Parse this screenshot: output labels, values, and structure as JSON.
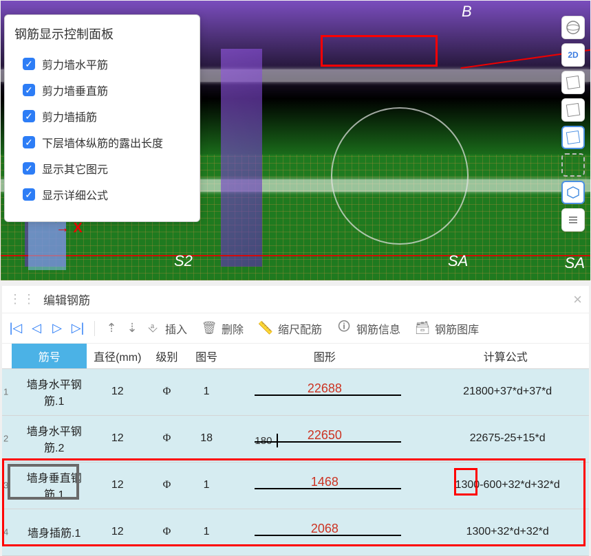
{
  "panel": {
    "title": "钢筋显示控制面板",
    "items": [
      "剪力墙水平筋",
      "剪力墙垂直筋",
      "剪力墙插筋",
      "下层墙体纵筋的露出长度",
      "显示其它图元",
      "显示详细公式"
    ]
  },
  "side_toolbar": {
    "items": [
      "globe",
      "2D",
      "cube",
      "cube2",
      "cube-blue",
      "dashed",
      "hex",
      "list"
    ],
    "labels": {
      "2D": "2D"
    }
  },
  "viewport_labels": {
    "b": "B",
    "s2": "S2",
    "sa": "SA",
    "sa2": "SA"
  },
  "viewport_axes": {
    "x": "→ X"
  },
  "bottom": {
    "title": "编辑钢筋",
    "toolbar": {
      "insert": "插入",
      "delete": "删除",
      "scale": "缩尺配筋",
      "info": "钢筋信息",
      "library": "钢筋图库"
    },
    "headers": {
      "name": "筋号",
      "dia": "直径(mm)",
      "lvl": "级别",
      "fig": "图号",
      "shape": "图形",
      "formula": "计算公式"
    },
    "rows": [
      {
        "n": "1",
        "name": "墙身水平钢筋.1",
        "dia": "12",
        "lvl": "⌀",
        "fig": "1",
        "shape_prefix": "",
        "shape_val": "22688",
        "formula": "21800+37*d+37*d"
      },
      {
        "n": "2",
        "name": "墙身水平钢筋.2",
        "dia": "12",
        "lvl": "⌀",
        "fig": "18",
        "shape_prefix": "180",
        "shape_val": "22650",
        "formula": "22675-25+15*d"
      },
      {
        "n": "3",
        "name": "墙身垂直钢筋.1",
        "dia": "12",
        "lvl": "⌀",
        "fig": "1",
        "shape_prefix": "",
        "shape_val": "1468",
        "formula": "1300-600+32*d+32*d"
      },
      {
        "n": "4",
        "name": "墙身插筋.1",
        "dia": "12",
        "lvl": "⌀",
        "fig": "1",
        "shape_prefix": "",
        "shape_val": "2068",
        "formula": "1300+32*d+32*d"
      }
    ]
  }
}
